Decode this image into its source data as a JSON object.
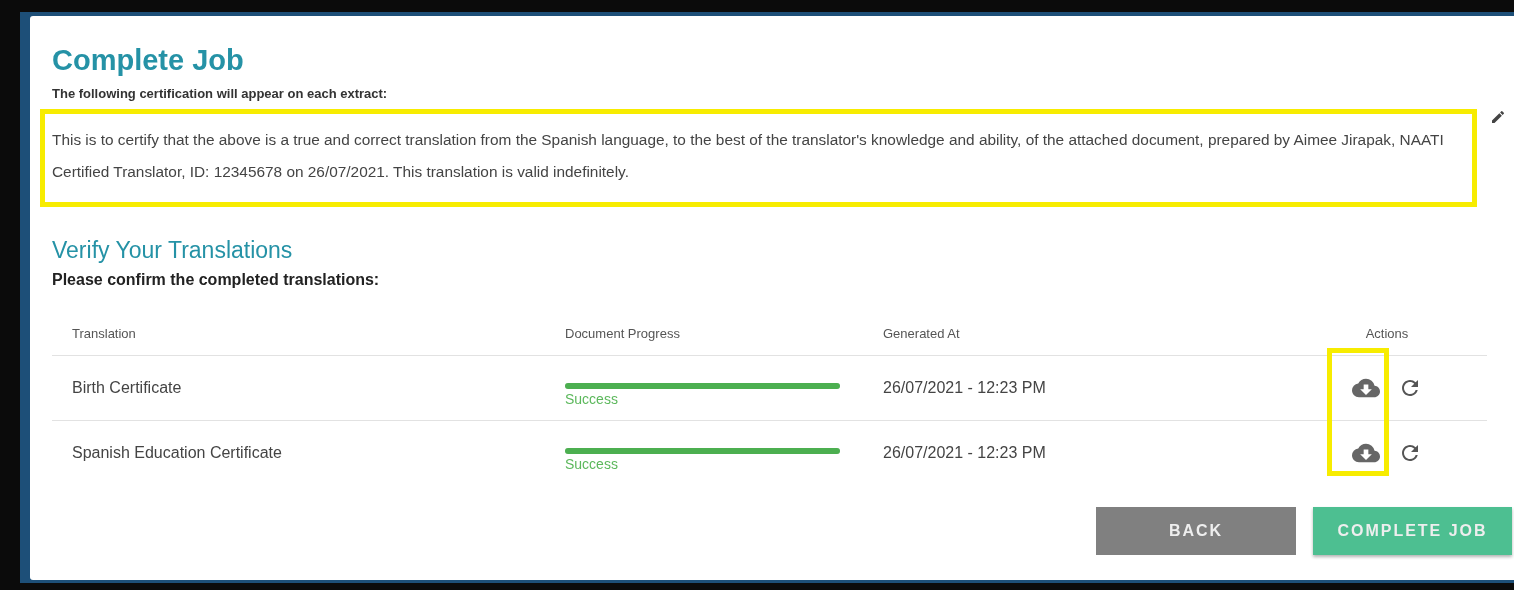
{
  "title": "Complete Job",
  "certification_label": "The following certification will appear on each extract:",
  "certification_text": "This is to certify that the above is a true and correct translation from the Spanish language, to the best of the translator's knowledge and ability, of the attached document, prepared by Aimee Jirapak, NAATI Certified Translator, ID: 12345678 on 26/07/2021. This translation is valid indefinitely.",
  "section_title": "Verify Your Translations",
  "section_prompt": "Please confirm the completed translations:",
  "table": {
    "columns": [
      "Translation",
      "Document Progress",
      "Generated At",
      "Actions"
    ],
    "rows": [
      {
        "translation": "Birth Certificate",
        "level": 1,
        "status": "Success",
        "generated_at": "26/07/2021 - 12:23 PM"
      },
      {
        "translation": "Spanish Education Certificate",
        "level": 1,
        "status": "Success",
        "generated_at": "26/07/2021 - 12:23 PM"
      }
    ]
  },
  "buttons": [
    {
      "label": "BACK",
      "kind": "secondary"
    },
    {
      "label": "COMPLETE JOB",
      "kind": "primary"
    }
  ]
}
